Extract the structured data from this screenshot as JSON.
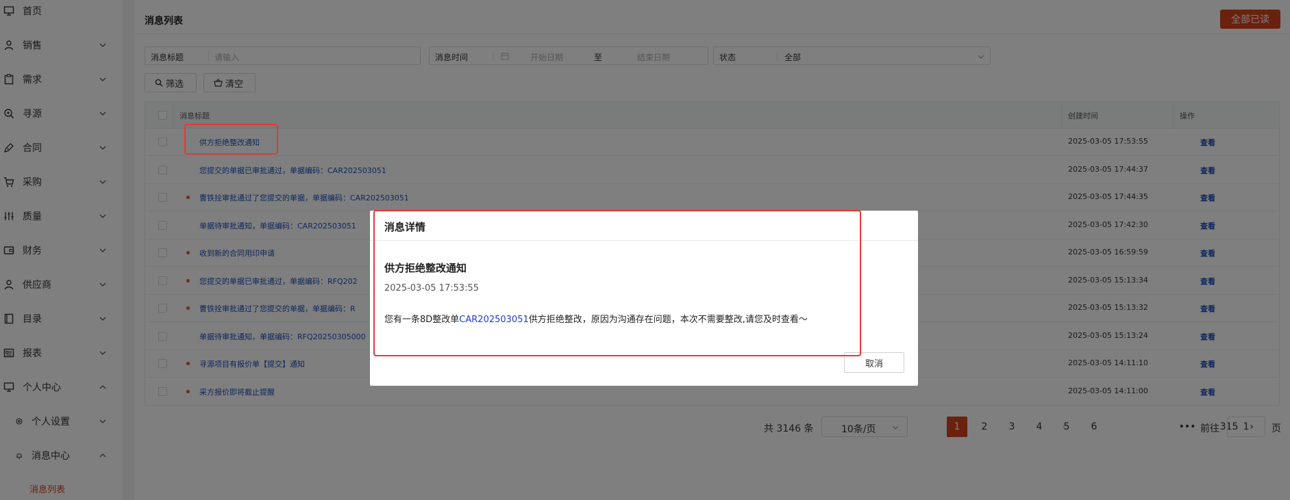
{
  "sidebar": {
    "items": [
      {
        "label": "首页",
        "icon": "monitor-icon",
        "chevron": "none"
      },
      {
        "label": "销售",
        "icon": "user-icon",
        "chevron": "down"
      },
      {
        "label": "需求",
        "icon": "clipboard-icon",
        "chevron": "down"
      },
      {
        "label": "寻源",
        "icon": "search-icon",
        "chevron": "down"
      },
      {
        "label": "合同",
        "icon": "pen-icon",
        "chevron": "down"
      },
      {
        "label": "采购",
        "icon": "cart-icon",
        "chevron": "down"
      },
      {
        "label": "质量",
        "icon": "sliders-icon",
        "chevron": "down"
      },
      {
        "label": "财务",
        "icon": "wallet-icon",
        "chevron": "down"
      },
      {
        "label": "供应商",
        "icon": "user-icon",
        "chevron": "down"
      },
      {
        "label": "目录",
        "icon": "book-icon",
        "chevron": "down"
      },
      {
        "label": "报表",
        "icon": "report-icon",
        "chevron": "down"
      },
      {
        "label": "个人中心",
        "icon": "monitor-icon",
        "chevron": "up"
      }
    ],
    "sub_items": [
      {
        "label": "个人设置",
        "icon": "gear-icon",
        "chevron": "down"
      },
      {
        "label": "消息中心",
        "icon": "bell-icon",
        "chevron": "up"
      }
    ],
    "active_leaf": "消息列表"
  },
  "header": {
    "title": "消息列表",
    "read_all": "全部已读"
  },
  "filters": {
    "title_label": "消息标题",
    "title_placeholder": "请输入",
    "time_label": "消息时间",
    "start_placeholder": "开始日期",
    "range_sep": "至",
    "end_placeholder": "结束日期",
    "status_label": "状态",
    "status_value": "全部"
  },
  "actions": {
    "filter": "筛选",
    "clear": "清空"
  },
  "table": {
    "headers": {
      "title": "消息标题",
      "created": "创建时间",
      "action": "操作"
    },
    "view_label": "查看",
    "rows": [
      {
        "title": "供方拒绝整改通知",
        "time": "2025-03-05 17:53:55",
        "unread": false
      },
      {
        "title": "您提交的单据已审批通过，单据编码：CAR202503051",
        "time": "2025-03-05 17:44:37",
        "unread": false
      },
      {
        "title": "曹铁拴审批通过了您提交的单据，单据编码：CAR202503051",
        "time": "2025-03-05 17:44:35",
        "unread": true
      },
      {
        "title": "单据待审批通知，单据编码：CAR202503051",
        "time": "2025-03-05 17:42:30",
        "unread": false
      },
      {
        "title": "收到新的合同用印申请",
        "time": "2025-03-05 16:59:59",
        "unread": true
      },
      {
        "title": "您提交的单据已审批通过，单据编码：RFQ202",
        "time": "2025-03-05 15:13:34",
        "unread": true
      },
      {
        "title": "曹铁拴审批通过了您提交的单据，单据编码：R",
        "time": "2025-03-05 15:13:32",
        "unread": true
      },
      {
        "title": "单据待审批通知，单据编码：RFQ20250305000",
        "time": "2025-03-05 15:13:24",
        "unread": false
      },
      {
        "title": "寻源项目有报价单【提交】通知",
        "time": "2025-03-05 14:11:10",
        "unread": true
      },
      {
        "title": "采方报价即将截止提醒",
        "time": "2025-03-05 14:11:00",
        "unread": true
      }
    ]
  },
  "pagination": {
    "total": "共 3146 条",
    "page_size": "10条/页",
    "pages": [
      "1",
      "2",
      "3",
      "4",
      "5",
      "6"
    ],
    "ellipsis": "•••",
    "last": "315",
    "goto_label": "前往",
    "goto_value": "1",
    "page_suffix": "页"
  },
  "dialog": {
    "title": "消息详情",
    "msg_title": "供方拒绝整改通知",
    "time": "2025-03-05 17:53:55",
    "content_pre": "您有一条8D整改单",
    "content_link": "CAR202503051",
    "content_post": "供方拒绝整改，原因为沟通存在问题，本次不需要整改,请您及时查看～",
    "cancel": "取消"
  },
  "colors": {
    "accent": "#d4431a",
    "link": "#1e4fb8",
    "highlight": "#e53935"
  }
}
